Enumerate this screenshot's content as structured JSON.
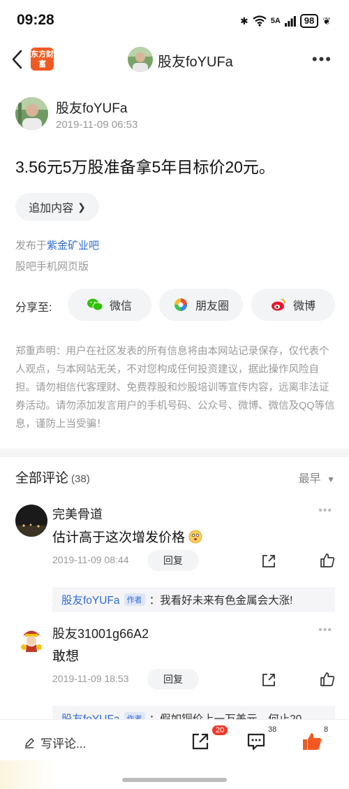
{
  "status_bar": {
    "time": "09:28",
    "signal": "5A",
    "battery": "98"
  },
  "nav": {
    "logo_text": "东方财富",
    "user_name": "股友foYUFa"
  },
  "post": {
    "author": "股友foYUFa",
    "time": "2019-11-09 06:53",
    "title": "3.56元5万股准备拿5年目标价20元。",
    "add_content_label": "追加内容",
    "source_prefix": "发布于",
    "source_name": "紫金矿业吧",
    "via": "股吧手机网页版"
  },
  "share": {
    "label": "分享至:",
    "wechat": "微信",
    "moments": "朋友圈",
    "weibo": "微博"
  },
  "disclaimer": "郑重声明：用户在社区发表的所有信息将由本网站记录保存，仅代表个人观点，与本网站无关，不对您构成任何投资建议，据此操作风险自担。请勿相信代客理财、免费荐股和炒股培训等宣传内容，远离非法证券活动。请勿添加发言用户的手机号码、公众号、微博、微信及QQ等信息，谨防上当受骗！",
  "comments": {
    "title": "全部评论",
    "count": "(38)",
    "sort": "最早",
    "items": [
      {
        "name": "完美骨道",
        "text": "估计高于这次增发价格",
        "time": "2019-11-09 08:44",
        "reply_label": "回复",
        "sub_reply": {
          "name": "股友foYUFa",
          "badge": "作者",
          "text": "：我看好未来有色金属会大涨!"
        }
      },
      {
        "name": "股友31001g66A2",
        "text": "敢想",
        "time": "2019-11-09 18:53",
        "reply_label": "回复",
        "sub_reply": {
          "name": "股友foYUFa",
          "badge": "作者",
          "text": "：假如铜价上一万美元，何止20"
        }
      }
    ]
  },
  "bottom_bar": {
    "write_label": "写评论...",
    "share_badge": "20",
    "comment_count": "38",
    "like_count": "8"
  },
  "colors": {
    "accent_orange": "#f05a22",
    "link_blue": "#2f6bd6",
    "badge_red": "#f0392b"
  }
}
